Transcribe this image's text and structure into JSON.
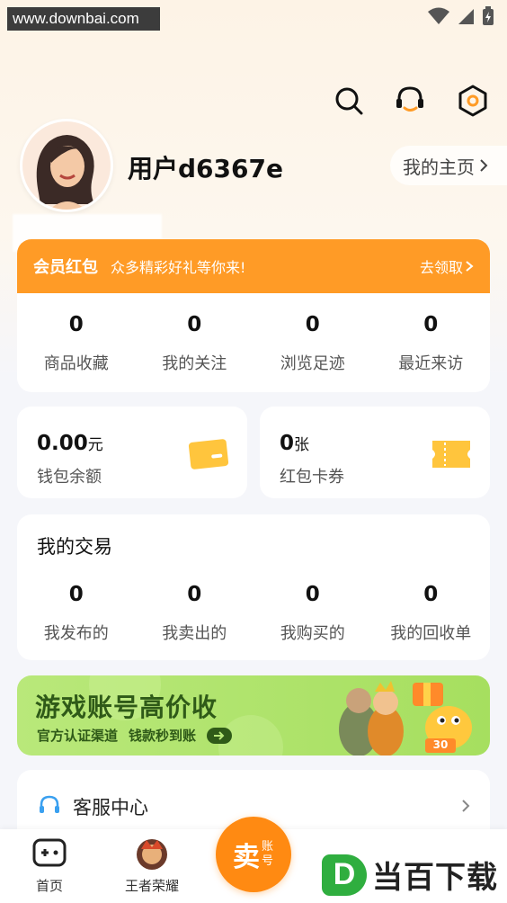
{
  "watermark": "www.downbai.com",
  "profile": {
    "username": "用户d6367e",
    "homepage_label": "我的主页"
  },
  "member": {
    "title": "会员红包",
    "subtitle": "众多精彩好礼等你来!",
    "action": "去领取"
  },
  "stats": [
    {
      "value": "0",
      "label": "商品收藏"
    },
    {
      "value": "0",
      "label": "我的关注"
    },
    {
      "value": "0",
      "label": "浏览足迹"
    },
    {
      "value": "0",
      "label": "最近来访"
    }
  ],
  "wallet": {
    "balance_value": "0.00",
    "balance_unit": "元",
    "balance_label": "钱包余额",
    "coupon_value": "0",
    "coupon_unit": "张",
    "coupon_label": "红包卡券"
  },
  "trades": {
    "title": "我的交易",
    "items": [
      {
        "value": "0",
        "label": "我发布的"
      },
      {
        "value": "0",
        "label": "我卖出的"
      },
      {
        "value": "0",
        "label": "我购买的"
      },
      {
        "value": "0",
        "label": "我的回收单"
      }
    ]
  },
  "promo": {
    "title": "游戏账号高价收",
    "sub1": "官方认证渠道",
    "sub2": "钱款秒到账",
    "badge": "30"
  },
  "service": {
    "label": "客服中心"
  },
  "nav": {
    "home": "首页",
    "game": "王者荣耀",
    "sell_big": "卖",
    "sell_small": "账号"
  },
  "brand": {
    "letter": "D",
    "text": "当百下载"
  },
  "colors": {
    "accent": "#ff9b26",
    "promo_green": "#a6df5f",
    "brand_green": "#2fae3f"
  }
}
